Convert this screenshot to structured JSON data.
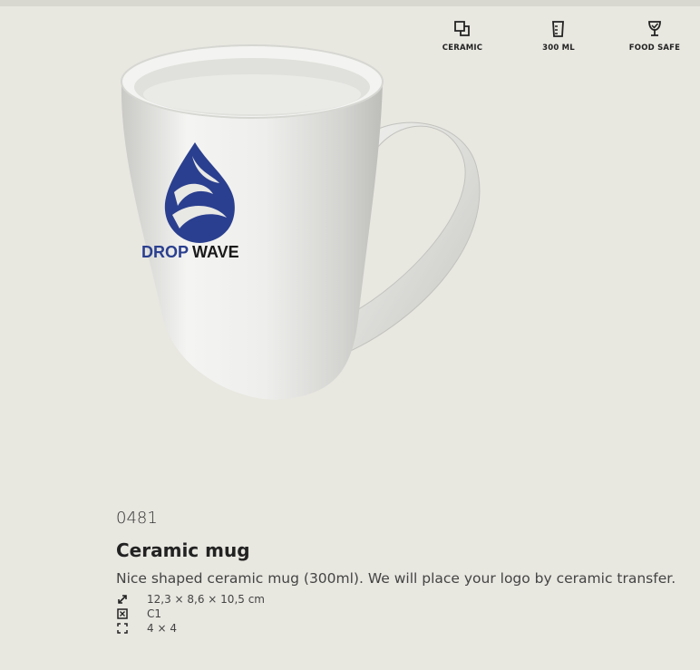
{
  "features": [
    {
      "label": "CERAMIC",
      "icon": "ceramic-icon"
    },
    {
      "label": "300 ML",
      "icon": "volume-icon"
    },
    {
      "label": "FOOD SAFE",
      "icon": "food-safe-icon"
    }
  ],
  "product": {
    "image": {
      "logo_text_left": "DROP",
      "logo_text_right": "WAVE",
      "logo_color": "#2a3f8f"
    },
    "code": "0481",
    "title": "Ceramic mug",
    "description": "Nice shaped ceramic mug (300ml). We will place your logo by ceramic transfer.",
    "specs": [
      {
        "icon": "dimensions-icon",
        "value": "12,3 × 8,6 × 10,5 cm"
      },
      {
        "icon": "print-method-icon",
        "value": "C1"
      },
      {
        "icon": "print-area-icon",
        "value": "4 × 4"
      }
    ]
  },
  "colors": {
    "background": "#e8e7e0",
    "text": "#222222",
    "logo": "#2a3f8f"
  }
}
